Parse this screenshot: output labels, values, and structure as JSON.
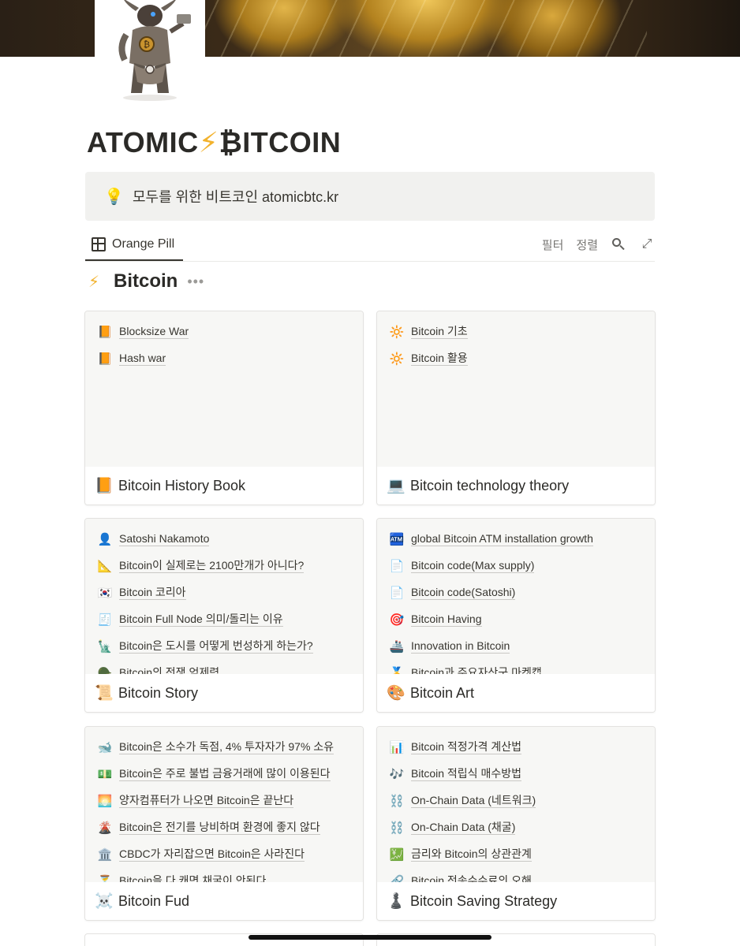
{
  "page": {
    "title_part1": "ATOMIC",
    "title_bolt": "⚡",
    "title_part2": "₿ITCOIN",
    "icon": "minotaur-hammer-icon"
  },
  "callout": {
    "icon": "lightbulb-icon",
    "text": "모두를 위한 비트코인 atomicbtc.kr"
  },
  "view": {
    "tab_label": "Orange Pill",
    "filter_label": "필터",
    "sort_label": "정렬"
  },
  "section": {
    "icon": "⚡",
    "name": "Bitcoin",
    "more": "•••"
  },
  "cards": [
    {
      "title": "Bitcoin History Book",
      "icon": "📙",
      "items": [
        {
          "icon": "📙",
          "label": "Blocksize War"
        },
        {
          "icon": "📙",
          "label": "Hash war"
        }
      ]
    },
    {
      "title": "Bitcoin technology theory",
      "icon": "💻",
      "items": [
        {
          "icon": "🔆",
          "label": "Bitcoin 기초"
        },
        {
          "icon": "🔆",
          "label": "Bitcoin 활용"
        }
      ]
    },
    {
      "title": "Bitcoin Story",
      "icon": "📜",
      "items": [
        {
          "icon": "👤",
          "label": "Satoshi Nakamoto"
        },
        {
          "icon": "📐",
          "label": "Bitcoin이 실제로는 2100만개가 아니다?"
        },
        {
          "icon": "🇰🇷",
          "label": "Bitcoin 코리아"
        },
        {
          "icon": "🧾",
          "label": "Bitcoin Full Node 의미/돌리는 이유"
        },
        {
          "icon": "🗽",
          "label": "Bitcoin은 도시를 어떻게 번성하게 하는가?"
        },
        {
          "icon": "🪖",
          "label": "Bitcoin의 전쟁 억제력"
        }
      ]
    },
    {
      "title": "Bitcoin Art",
      "icon": "🎨",
      "items": [
        {
          "icon": "🏧",
          "label": "global Bitcoin ATM installation growth"
        },
        {
          "icon": "📄",
          "label": "Bitcoin code(Max supply)"
        },
        {
          "icon": "📄",
          "label": "Bitcoin code(Satoshi)"
        },
        {
          "icon": "🎯",
          "label": "Bitcoin Having"
        },
        {
          "icon": "🚢",
          "label": "Innovation in Bitcoin"
        },
        {
          "icon": "🥇",
          "label": "Bitcoin과 주요자산군 마켓캡"
        }
      ]
    },
    {
      "title": "Bitcoin Fud",
      "icon": "☠️",
      "items": [
        {
          "icon": "🐋",
          "label": "Bitcoin은 소수가 독점, 4% 투자자가 97% 소유"
        },
        {
          "icon": "💵",
          "label": "Bitcoin은 주로 불법 금융거래에 많이 이용된다"
        },
        {
          "icon": "🌅",
          "label": "양자컴퓨터가 나오면 Bitcoin은 끝난다"
        },
        {
          "icon": "🌋",
          "label": "Bitcoin은 전기를 낭비하며 환경에 좋지 않다"
        },
        {
          "icon": "🏛️",
          "label": "CBDC가 자리잡으면 Bitcoin은 사라진다"
        },
        {
          "icon": "⏳",
          "label": "Bitcoin을 다 캐면 채굴이 안된다"
        }
      ]
    },
    {
      "title": "Bitcoin Saving Strategy",
      "icon": "♟️",
      "items": [
        {
          "icon": "📊",
          "label": "Bitcoin 적정가격 계산법"
        },
        {
          "icon": "🎶",
          "label": "Bitcoin 적립식 매수방법"
        },
        {
          "icon": "⛓️",
          "label": "On-Chain Data (네트워크)"
        },
        {
          "icon": "⛓️",
          "label": "On-Chain Data (채굴)"
        },
        {
          "icon": "💹",
          "label": "금리와 Bitcoin의 상관관계"
        },
        {
          "icon": "🔗",
          "label": "Bitcoin 전송수수료의 오해"
        }
      ]
    }
  ]
}
